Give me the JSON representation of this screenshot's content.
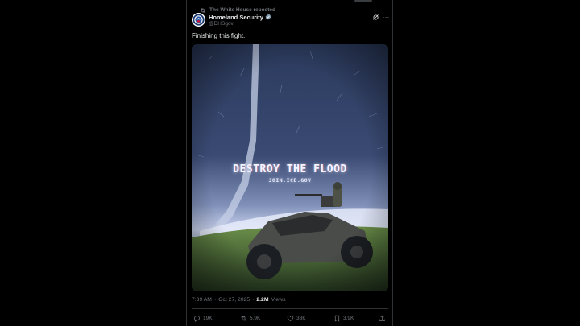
{
  "repost": {
    "label": "The White House reposted"
  },
  "author": {
    "name": "Homeland Security",
    "handle": "@DHSgov"
  },
  "tweet": {
    "text": "Finishing this fight."
  },
  "media": {
    "title": "DESTROY THE FLOOD",
    "subtitle": "JOIN.ICE.GOV"
  },
  "meta": {
    "time": "7:39 AM",
    "separator": "·",
    "date": "Oct 27, 2025",
    "separator2": "·",
    "views_count": "2.2M",
    "views_label": "Views"
  },
  "actions": {
    "replies": "19K",
    "reposts": "5.9K",
    "likes": "38K",
    "bookmarks": "3.9K"
  },
  "colors": {
    "background": "#000000",
    "text": "#e7e9ea",
    "muted": "#71767b",
    "verified": "#829aab",
    "border": "#2f3336"
  },
  "icons": [
    "repost-icon",
    "dhs-seal-icon",
    "verified-badge-icon",
    "grok-icon",
    "more-icon",
    "reply-icon",
    "retweet-icon",
    "like-icon",
    "bookmark-icon",
    "share-icon"
  ]
}
